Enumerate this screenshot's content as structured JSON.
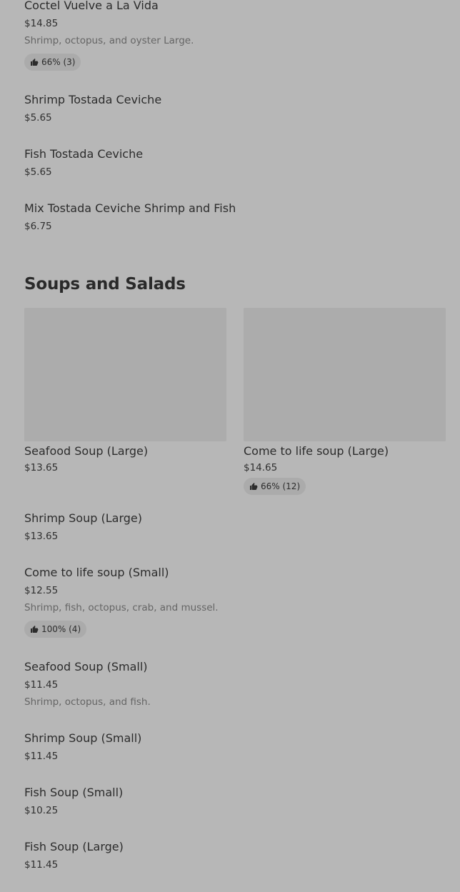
{
  "items_top": [
    {
      "name": "Coctel Vuelve a La Vida",
      "price": "$14.85",
      "description": "Shrimp, octopus, and oyster Large.",
      "rating": "66% (3)"
    },
    {
      "name": "Shrimp Tostada Ceviche",
      "price": "$5.65"
    },
    {
      "name": "Fish Tostada Ceviche",
      "price": "$5.65"
    },
    {
      "name": "Mix Tostada Ceviche Shrimp and Fish",
      "price": "$6.75"
    }
  ],
  "section": {
    "title": "Soups and Salads"
  },
  "featured": [
    {
      "name": "Seafood Soup (Large)",
      "price": "$13.65"
    },
    {
      "name": "Come to life soup (Large)",
      "price": "$14.65",
      "rating": "66% (12)"
    }
  ],
  "items_bottom": [
    {
      "name": "Shrimp Soup (Large)",
      "price": "$13.65"
    },
    {
      "name": "Come to life soup (Small)",
      "price": "$12.55",
      "description": "Shrimp, fish, octopus, crab, and mussel.",
      "rating": "100% (4)"
    },
    {
      "name": "Seafood Soup (Small)",
      "price": "$11.45",
      "description": "Shrimp, octopus, and fish."
    },
    {
      "name": "Shrimp Soup (Small)",
      "price": "$11.45"
    },
    {
      "name": "Fish Soup (Small)",
      "price": "$10.25"
    },
    {
      "name": "Fish Soup (Large)",
      "price": "$11.45"
    }
  ]
}
